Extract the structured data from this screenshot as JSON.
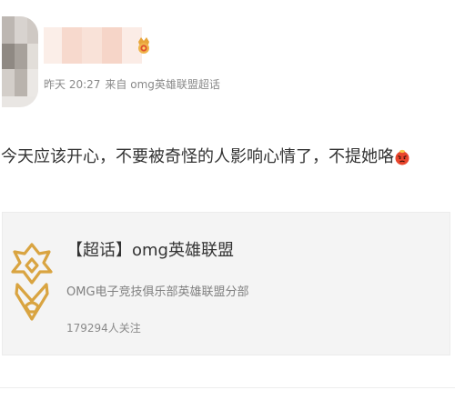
{
  "post": {
    "meta": {
      "time": "昨天 20:27",
      "source": "来自 omg英雄联盟超话"
    },
    "text": "今天应该开心，不要被奇怪的人影响心情了，不提她咯"
  },
  "topic_card": {
    "title": "【超话】omg英雄联盟",
    "description": "OMG电子竞技俱乐部英雄联盟分部",
    "followers": "179294人关注"
  },
  "colors": {
    "accent_gold": "#d9a441",
    "text_primary": "#333333",
    "text_secondary": "#8a8a8a",
    "card_bg": "#f4f4f4"
  },
  "icons": {
    "avatar": "blurred-avatar",
    "badge": "crown-badge-icon",
    "emoji": "angry-emoji-icon",
    "topic_logo": "omg-logo-icon"
  }
}
